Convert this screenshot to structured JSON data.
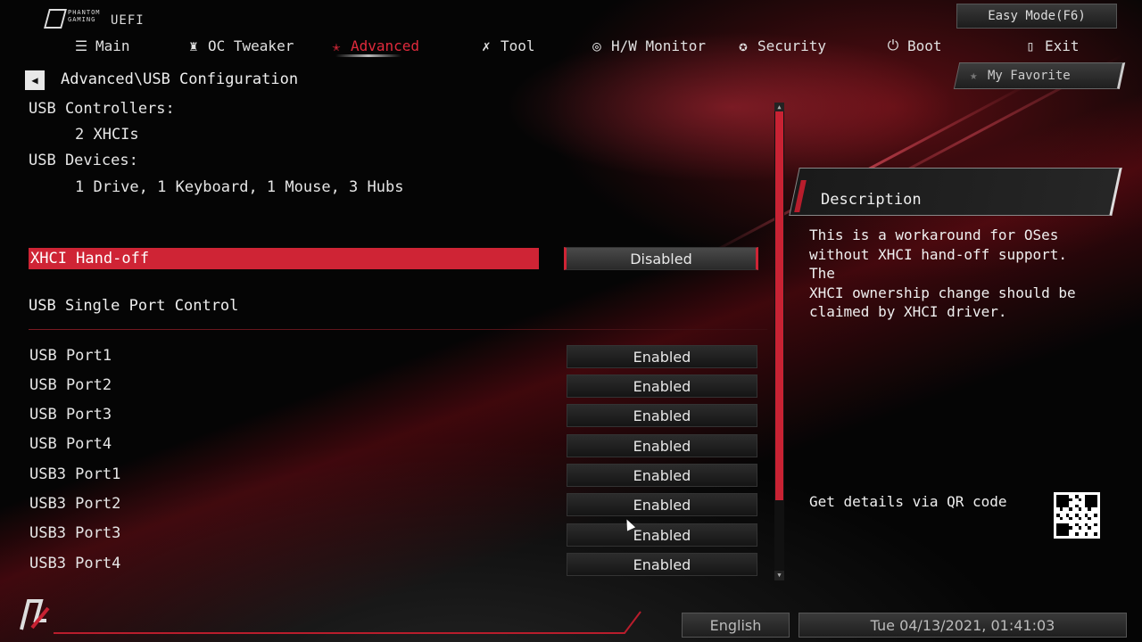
{
  "header": {
    "logo_brand": "PHANTOM GAMING",
    "logo_suffix": "UEFI",
    "easy_mode_label": "Easy Mode(F6)"
  },
  "nav": {
    "items": [
      {
        "label": "Main",
        "icon": "list-icon"
      },
      {
        "label": "OC Tweaker",
        "icon": "rocket-icon"
      },
      {
        "label": "Advanced",
        "icon": "star-icon",
        "active": true
      },
      {
        "label": "Tool",
        "icon": "tools-icon"
      },
      {
        "label": "H/W Monitor",
        "icon": "monitor-icon"
      },
      {
        "label": "Security",
        "icon": "shield-icon"
      },
      {
        "label": "Boot",
        "icon": "power-icon"
      },
      {
        "label": "Exit",
        "icon": "exit-door-icon"
      }
    ]
  },
  "favorite": {
    "label": "My Favorite"
  },
  "breadcrumb": "Advanced\\USB Configuration",
  "usb_info": {
    "controllers_label": "USB Controllers:",
    "controllers_value": "2 XHCIs",
    "devices_label": "USB Devices:",
    "devices_value": "1 Drive, 1 Keyboard, 1 Mouse, 3 Hubs"
  },
  "settings": {
    "xhci_label": "XHCI Hand-off",
    "xhci_value": "Disabled",
    "single_port_title": "USB Single Port Control",
    "ports": [
      {
        "label": "USB Port1",
        "value": "Enabled"
      },
      {
        "label": "USB Port2",
        "value": "Enabled"
      },
      {
        "label": "USB Port3",
        "value": "Enabled"
      },
      {
        "label": "USB Port4",
        "value": "Enabled"
      },
      {
        "label": "USB3 Port1",
        "value": "Enabled"
      },
      {
        "label": "USB3 Port2",
        "value": "Enabled"
      },
      {
        "label": "USB3 Port3",
        "value": "Enabled"
      },
      {
        "label": "USB3 Port4",
        "value": "Enabled"
      }
    ]
  },
  "description": {
    "title": "Description",
    "text": "This is a workaround for OSes\nwithout XHCI hand-off support. The\nXHCI ownership change should be\nclaimed by XHCI driver.",
    "qr_text": "Get details via QR code"
  },
  "footer": {
    "language": "English",
    "datetime": "Tue 04/13/2021, 01:41:03"
  },
  "colors": {
    "accent": "#cf2435",
    "background": "#050505",
    "text": "#e6e6e6"
  }
}
